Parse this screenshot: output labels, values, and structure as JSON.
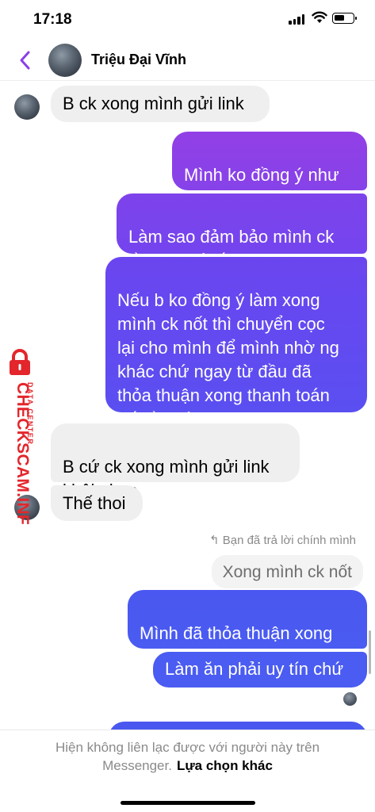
{
  "status_bar": {
    "time": "17:18"
  },
  "header": {
    "contact_name": "Triệu Đại Vĩnh"
  },
  "messages": [
    {
      "from": "them",
      "text": "B ck xong mình gửi link"
    },
    {
      "from": "me",
      "text": "Mình ko đồng ý như\nvậy đâu"
    },
    {
      "from": "me",
      "text": "Làm sao đảm bảo mình ck\nrồi nick có lấy đc ko"
    },
    {
      "from": "me",
      "text": "Nếu b ko đồng ý làm xong\nmình ck nốt thì chuyển cọc\nlại cho mình để mình nhờ ng\nkhác chứ ngay từ đầu đã\nthỏa thuận xong thanh toán\nnốt rồi mà"
    },
    {
      "from": "them",
      "text": "B cứ ck xong mình gửi link\nkhôi phục"
    },
    {
      "from": "them",
      "text": "Thế thoi"
    },
    {
      "from": "me",
      "text": "Mình đã thỏa thuận xong\nmình ck nốt rồi mà"
    },
    {
      "from": "me",
      "text": "Làm ăn phải uy tín chứ"
    }
  ],
  "reply": {
    "note": "Bạn đã trả lời chính mình",
    "quoted_text": "Xong mình ck nốt",
    "icon": "reply-arrow-icon"
  },
  "footer": {
    "line1": "Hiện không liên lạc được với người này trên",
    "line2_prefix": "Messenger.",
    "line2_action": "Lựa chọn khác"
  },
  "watermark": {
    "brand": "CHECKSCAM.INFO",
    "tagline": "DATA CENTER"
  },
  "colors": {
    "gradient_top": "#8f3de6",
    "gradient_mid": "#6a3ef0",
    "gradient_bottom": "#3f5ff2",
    "incoming_bubble": "#efefef",
    "back_chevron": "#8b3fe6",
    "watermark_red": "#e3262c"
  }
}
